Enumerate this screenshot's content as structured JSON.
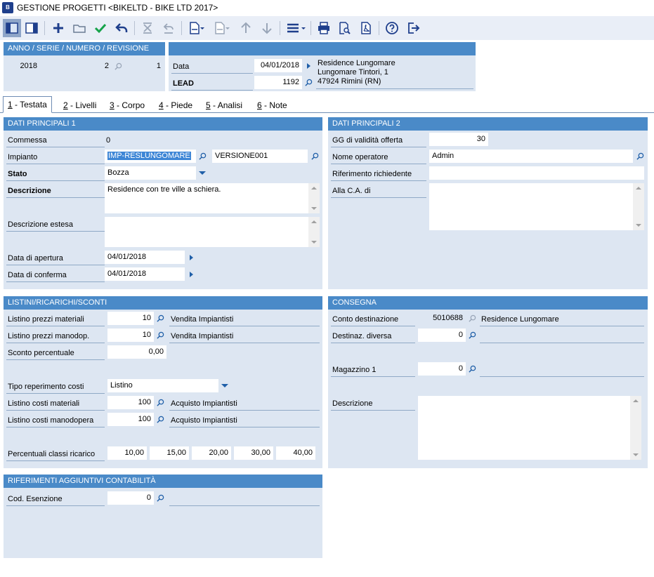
{
  "window": {
    "title": "GESTIONE PROGETTI <BIKELTD - BIKE LTD 2017>",
    "logo": "B"
  },
  "toolbar": {
    "icons": [
      "panel-left-icon",
      "panel-right-icon",
      "add-icon",
      "open-folder-icon",
      "confirm-check-icon",
      "undo-icon",
      "delete-icon",
      "revert-icon",
      "document-icon",
      "document-disabled-icon",
      "arrow-up-icon",
      "arrow-down-icon",
      "menu-icon",
      "print-icon",
      "print-preview-icon",
      "pdf-icon",
      "help-icon",
      "exit-icon"
    ]
  },
  "header": {
    "id_panel_title": "ANNO / SERIE / NUMERO / REVISIONE",
    "anno": "2018",
    "serie": "",
    "numero": "2",
    "revisione": "1",
    "data_label": "Data",
    "data_value": "04/01/2018",
    "lead_label": "LEAD",
    "lead_value": "1192",
    "address_line1": "Residence Lungomare",
    "address_line2": "Lungomare Tintori, 1",
    "address_line3": "47924 Rimini (RN)"
  },
  "tabs": [
    {
      "key": "1",
      "label": " - Testata",
      "active": true
    },
    {
      "key": "2",
      "label": " - Livelli"
    },
    {
      "key": "3",
      "label": " - Corpo"
    },
    {
      "key": "4",
      "label": " - Piede"
    },
    {
      "key": "5",
      "label": " - Analisi"
    },
    {
      "key": "6",
      "label": " - Note"
    }
  ],
  "dp1": {
    "title": "DATI PRINCIPALI 1",
    "commessa_label": "Commessa",
    "commessa_value": "0",
    "impianto_label": "Impianto",
    "impianto_value": "IMP-RESLUNGOMARE",
    "impianto_version": "VERSIONE001",
    "stato_label": "Stato",
    "stato_value": "Bozza",
    "descrizione_label": "Descrizione",
    "descrizione_value": "Residence con tre ville a schiera.",
    "desc_estesa_label": "Descrizione estesa",
    "desc_estesa_value": "",
    "apertura_label": "Data di apertura",
    "apertura_value": "04/01/2018",
    "conferma_label": "Data di conferma",
    "conferma_value": "04/01/2018"
  },
  "dp2": {
    "title": "DATI PRINCIPALI 2",
    "gg_label": "GG di validità offerta",
    "gg_value": "30",
    "operatore_label": "Nome operatore",
    "operatore_value": "Admin",
    "riferimento_label": "Riferimento richiedente",
    "riferimento_value": "",
    "ca_label": "Alla C.A. di",
    "ca_value": ""
  },
  "listini": {
    "title": "LISTINI/RICARICHI/SCONTI",
    "lpm_label": "Listino prezzi materiali",
    "lpm_value": "10",
    "lpm_desc": "Vendita Impiantisti",
    "lpmo_label": "Listino prezzi manodop.",
    "lpmo_value": "10",
    "lpmo_desc": "Vendita Impiantisti",
    "sconto_label": "Sconto percentuale",
    "sconto_value": "0,00",
    "tipo_label": "Tipo reperimento costi",
    "tipo_value": "Listino",
    "lcm_label": "Listino costi materiali",
    "lcm_value": "100",
    "lcm_desc": "Acquisto Impiantisti",
    "lcmo_label": "Listino costi manodopera",
    "lcmo_value": "100",
    "lcmo_desc": "Acquisto Impiantisti",
    "perc_label": "Percentuali classi ricarico",
    "perc_values": [
      "10,00",
      "15,00",
      "20,00",
      "30,00",
      "40,00"
    ]
  },
  "consegna": {
    "title": "CONSEGNA",
    "conto_label": "Conto destinazione",
    "conto_value": "5010688",
    "conto_desc": "Residence Lungomare",
    "destinaz_label": "Destinaz. diversa",
    "destinaz_value": "0",
    "destinaz_desc": "",
    "magazzino_label": "Magazzino 1",
    "magazzino_value": "0",
    "magazzino_desc": "",
    "descrizione_label": "Descrizione",
    "descrizione_value": ""
  },
  "riferimenti": {
    "title": "RIFERIMENTI AGGIUNTIVI CONTABILITÀ",
    "esenzione_label": "Cod. Esenzione",
    "esenzione_value": "0",
    "esenzione_desc": ""
  }
}
